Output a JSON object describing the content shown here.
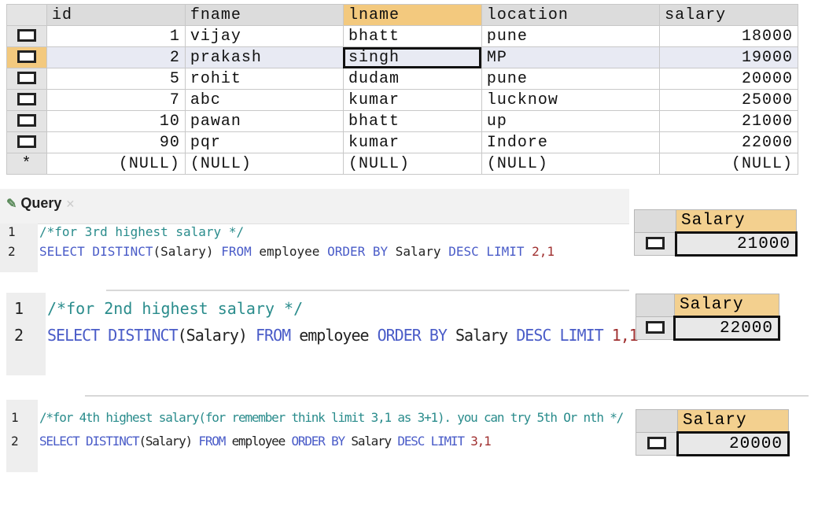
{
  "table": {
    "columns": [
      "id",
      "fname",
      "lname",
      "location",
      "salary"
    ],
    "rows": [
      [
        "1",
        "vijay",
        "bhatt",
        "pune",
        "18000"
      ],
      [
        "2",
        "prakash",
        "singh",
        "MP",
        "19000"
      ],
      [
        "5",
        "rohit",
        "dudam",
        "pune",
        "20000"
      ],
      [
        "7",
        "abc",
        "kumar",
        "lucknow",
        "25000"
      ],
      [
        "10",
        "pawan",
        "bhatt",
        "up",
        "21000"
      ],
      [
        "90",
        "pqr",
        "kumar",
        "Indore",
        "22000"
      ]
    ],
    "new_row_marker": "*",
    "null_text": "(NULL)"
  },
  "query_tab": {
    "label": "Query"
  },
  "queries": [
    {
      "line_numbers": [
        "1",
        "2"
      ],
      "comment": "/*for 3rd highest salary */",
      "sql": {
        "kw1": "SELECT DISTINCT",
        "p1": "(Salary) ",
        "kw2": "FROM",
        "p2": " employee ",
        "kw3": "ORDER BY",
        "p3": " Salary ",
        "kw4": "DESC LIMIT",
        "num": " 2,1"
      },
      "result_header": "Salary",
      "result_value": "21000"
    },
    {
      "line_numbers": [
        "1",
        "2"
      ],
      "comment": "/*for 2nd highest salary */",
      "sql": {
        "kw1": "SELECT DISTINCT",
        "p1": "(Salary) ",
        "kw2": "FROM",
        "p2": " employee ",
        "kw3": "ORDER BY",
        "p3": " Salary ",
        "kw4": "DESC LIMIT",
        "num": " 1,1"
      },
      "result_header": "Salary",
      "result_value": "22000"
    },
    {
      "line_numbers": [
        "1",
        "2"
      ],
      "comment": "/*for 4th highest salary(for remember think limit 3,1 as 3+1). you can try 5th Or nth */",
      "sql": {
        "kw1": "SELECT DISTINCT",
        "p1": "(Salary) ",
        "kw2": "FROM",
        "p2": " employee ",
        "kw3": "ORDER BY",
        "p3": " Salary ",
        "kw4": "DESC LIMIT",
        "num": " 3,1"
      },
      "result_header": "Salary",
      "result_value": "20000"
    }
  ],
  "colors": {
    "selected_header": "#f3c97e",
    "keyword": "#4a5cc8",
    "comment": "#2a8c8c",
    "number": "#a03030"
  }
}
